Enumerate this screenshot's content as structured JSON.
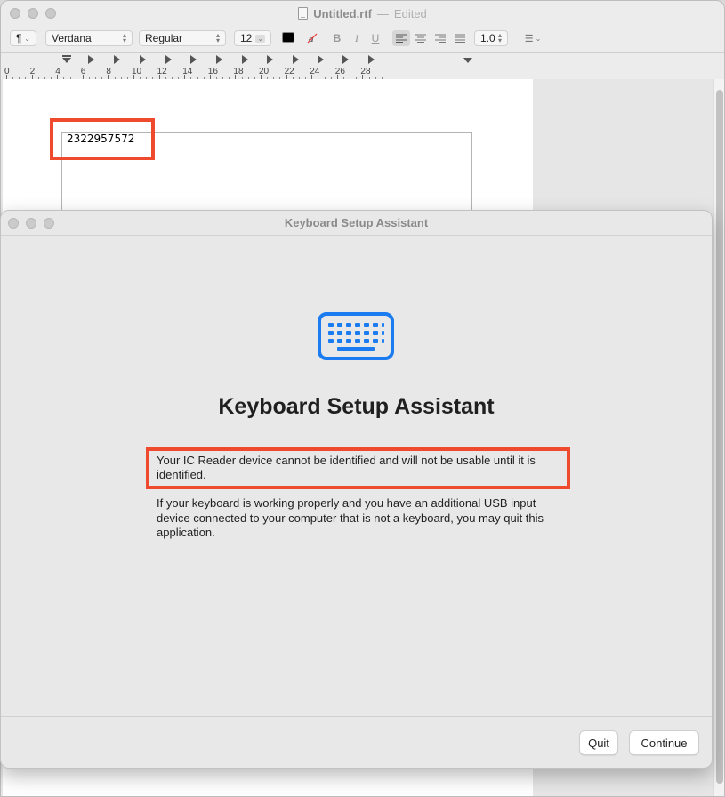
{
  "textedit": {
    "filename": "Untitled.rtf",
    "separator": "—",
    "status": "Edited",
    "toolbar": {
      "paragraph_style": "¶",
      "font_family": "Verdana",
      "font_style": "Regular",
      "font_size": "12",
      "text_color": "#000000",
      "bold": "B",
      "italic": "I",
      "underline": "U",
      "line_spacing": "1.0",
      "list_bullet": "☰"
    },
    "ruler_labels": [
      "0",
      "2",
      "4",
      "6",
      "8",
      "10",
      "12",
      "14",
      "16",
      "18",
      "20",
      "22",
      "24",
      "26",
      "28"
    ],
    "document_text": "2322957572"
  },
  "dialog": {
    "window_title": "Keyboard Setup Assistant",
    "heading": "Keyboard Setup Assistant",
    "message_primary": "Your IC Reader device cannot be identified and will not be usable until it is identified.",
    "message_secondary": "If your keyboard is working properly and you have an additional USB input device connected to your computer that is not a keyboard, you may quit this application.",
    "quit_label": "Quit",
    "continue_label": "Continue",
    "icon": "keyboard-icon",
    "icon_color": "#1a7cf0"
  },
  "annotations": {
    "highlight_color": "#ef4a2e"
  }
}
